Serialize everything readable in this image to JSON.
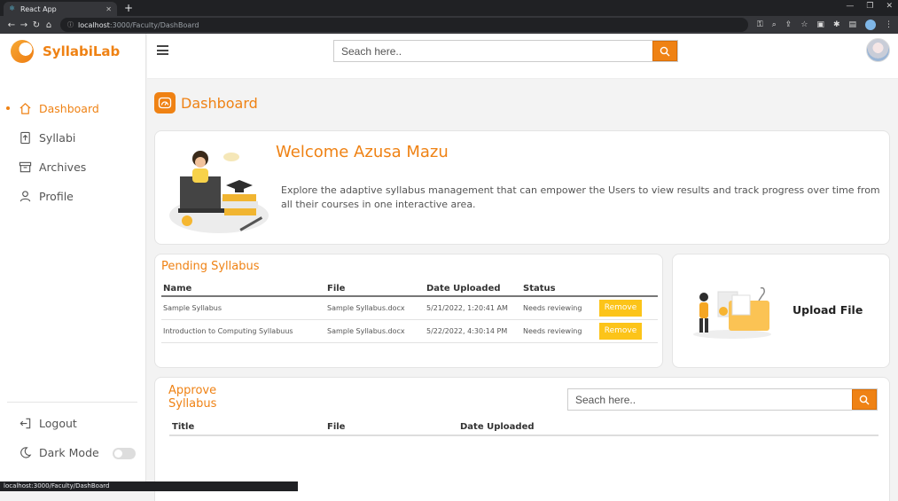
{
  "browser": {
    "tab_title": "React App",
    "new_tab": "+",
    "url_host": "localhost",
    "url_path": ":3000/Faculty/DashBoard",
    "status_url": "localhost:3000/Faculty/DashBoard"
  },
  "app": {
    "logo_text": "SyllabiLab",
    "search_placeholder": "Seach here.."
  },
  "sidebar": {
    "items": [
      {
        "label": "Dashboard",
        "icon": "home-icon",
        "active": true
      },
      {
        "label": "Syllabi",
        "icon": "upload-file-icon",
        "active": false
      },
      {
        "label": "Archives",
        "icon": "archive-icon",
        "active": false
      },
      {
        "label": "Profile",
        "icon": "user-icon",
        "active": false
      }
    ],
    "logout_label": "Logout",
    "dark_mode_label": "Dark Mode",
    "dark_mode_on": false
  },
  "main": {
    "page_title": "Dashboard",
    "welcome": {
      "title": "Welcome Azusa Mazu",
      "text": "Explore the adaptive syllabus management that can empower the Users to view results and track progress over time from all their courses in one interactive area."
    },
    "pending": {
      "title": "Pending Syllabus",
      "columns": [
        "Name",
        "File",
        "Date Uploaded",
        "Status"
      ],
      "rows": [
        {
          "name": "Sample Syllabus",
          "file": "Sample Syllabus.docx",
          "date": "5/21/2022, 1:20:41 AM",
          "status": "Needs reviewing",
          "action": "Remove"
        },
        {
          "name": "Introduction to Computing Syllabuus",
          "file": "Sample Syllabus.docx",
          "date": "5/22/2022, 4:30:14 PM",
          "status": "Needs reviewing",
          "action": "Remove"
        }
      ]
    },
    "upload": {
      "label": "Upload File"
    },
    "approve": {
      "title": "Approve Syllabus",
      "search_placeholder": "Seach here..",
      "columns": [
        "Title",
        "File",
        "Date Uploaded"
      ]
    }
  },
  "colors": {
    "accent": "#ef8214",
    "button_yellow": "#fcc419"
  }
}
